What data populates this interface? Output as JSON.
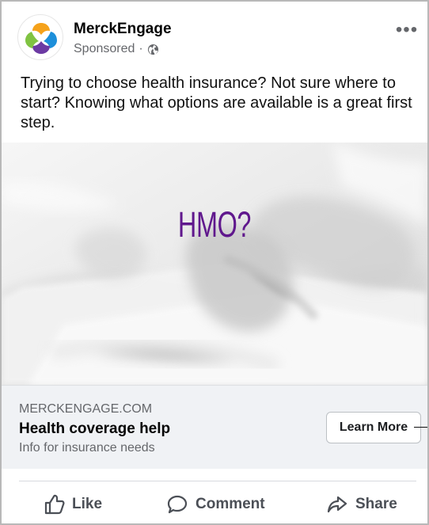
{
  "post": {
    "page_name": "MerckEngage",
    "sponsored_label": "Sponsored",
    "separator": "·",
    "privacy_icon": "globe-icon",
    "menu_label": "•••",
    "caption": "Trying to choose health insurance? Not sure where to start? Knowing what options are available is a great first step.",
    "image_text": "HMO?"
  },
  "link_preview": {
    "domain": "MERCKENGAGE.COM",
    "title": "Health coverage help",
    "description": "Info for insurance needs",
    "button_label": "Learn More"
  },
  "actions": [
    {
      "label": "Like",
      "icon": "thumbs-up-icon"
    },
    {
      "label": "Comment",
      "icon": "comment-icon"
    },
    {
      "label": "Share",
      "icon": "share-icon"
    }
  ],
  "colors": {
    "brand_orange": "#f5a21b",
    "brand_green": "#80c342",
    "brand_blue": "#1d8fda",
    "brand_purple": "#6c3aa3",
    "headline_purple": "#60188d",
    "link_background": "#f0f2f5",
    "secondary_text": "#65676b"
  }
}
